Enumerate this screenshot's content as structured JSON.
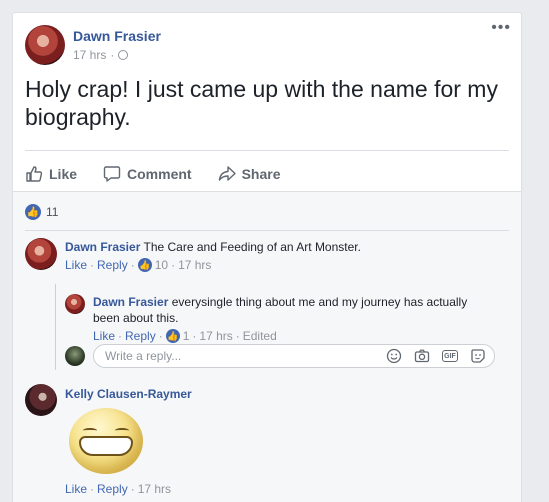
{
  "post": {
    "author": "Dawn Frasier",
    "time": "17 hrs",
    "text": "Holy crap! I just came up with the name for my biography.",
    "more": "•••"
  },
  "actions": {
    "like": "Like",
    "comment": "Comment",
    "share": "Share"
  },
  "likes": {
    "count": "11"
  },
  "comments": [
    {
      "author": "Dawn Frasier",
      "text": "The Care and Feeding of an Art Monster.",
      "like_label": "Like",
      "reply_label": "Reply",
      "likes": "10",
      "time": "17 hrs"
    },
    {
      "author": "Kelly Clausen-Raymer",
      "like_label": "Like",
      "reply_label": "Reply",
      "time": "17 hrs"
    }
  ],
  "reply": {
    "author": "Dawn Frasier",
    "text": "everysingle thing about me and my journey has actually been about this.",
    "like_label": "Like",
    "reply_label": "Reply",
    "likes": "1",
    "time": "17 hrs",
    "edited": "Edited"
  },
  "reply_box": {
    "placeholder": "Write a reply..."
  },
  "separator": "·",
  "icons": {
    "like": "thumbs-up-icon",
    "comment": "comment-icon",
    "share": "share-icon",
    "globe": "globe-icon",
    "emoji": "emoji-icon",
    "camera": "camera-icon",
    "gif": "GIF",
    "sticker": "sticker-icon"
  },
  "colors": {
    "link": "#365899",
    "accent": "#4267b2",
    "muted": "#90949c"
  }
}
